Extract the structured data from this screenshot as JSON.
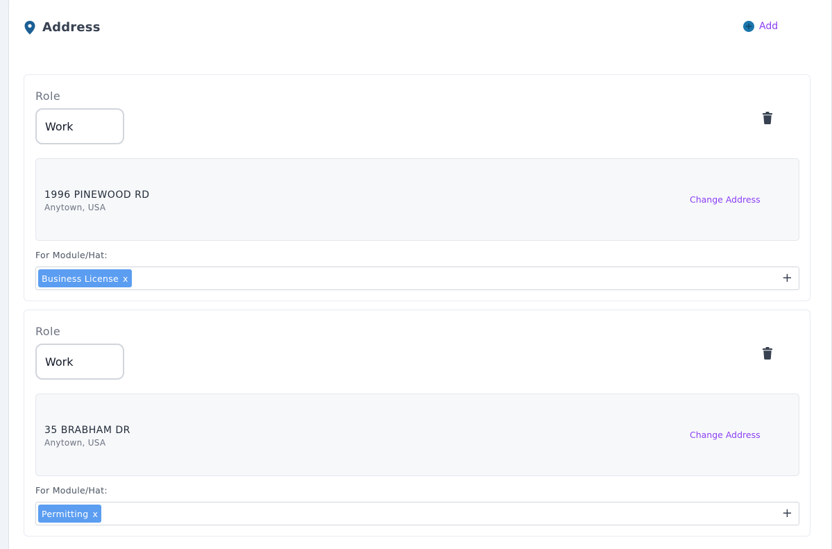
{
  "section": {
    "title": "Address",
    "icon": "map-pin-icon",
    "add_label": "Add",
    "add_icon": "plus-circle-icon"
  },
  "colors": {
    "accent": "#8b3ff5",
    "icon_blue": "#1c75ac",
    "tag_blue": "#5b9df1"
  },
  "addresses": [
    {
      "role_label": "Role",
      "role_value": "Work",
      "street": "1996 PINEWOOD RD",
      "city": "Anytown, USA",
      "change_label": "Change Address",
      "module_label": "For Module/Hat:",
      "tags": [
        {
          "label": "Business License",
          "remove": "x"
        }
      ],
      "add_module_symbol": "+"
    },
    {
      "role_label": "Role",
      "role_value": "Work",
      "street": "35 BRABHAM DR",
      "city": "Anytown, USA",
      "change_label": "Change Address",
      "module_label": "For Module/Hat:",
      "tags": [
        {
          "label": "Permitting",
          "remove": "x"
        }
      ],
      "add_module_symbol": "+"
    }
  ]
}
